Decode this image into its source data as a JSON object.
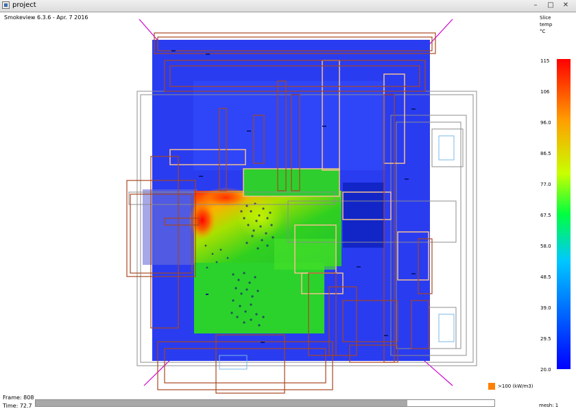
{
  "window": {
    "title": "project",
    "minimize": "–",
    "maximize": "□",
    "close": "✕"
  },
  "viewer": {
    "version": "Smokeview 6.3.6  -  Apr.  7 2016"
  },
  "legend": {
    "quantity_type": "Slice",
    "quantity": "temp",
    "unit": "°C",
    "values": [
      "115",
      "106",
      "96.0",
      "86.5",
      "77.0",
      "67.5",
      "58.0",
      "48.5",
      "39.0",
      "29.5",
      "20.0"
    ],
    "colors": {
      "min": "#0000ff",
      "max": "#ff0000"
    }
  },
  "hrrpuv": {
    "label": ">100 (kW/m3)",
    "color": "#ff8000"
  },
  "status": {
    "frame": "Frame: 808",
    "time": "Time: 72.7",
    "mesh": "mesh: 1",
    "progress": 0.81
  }
}
